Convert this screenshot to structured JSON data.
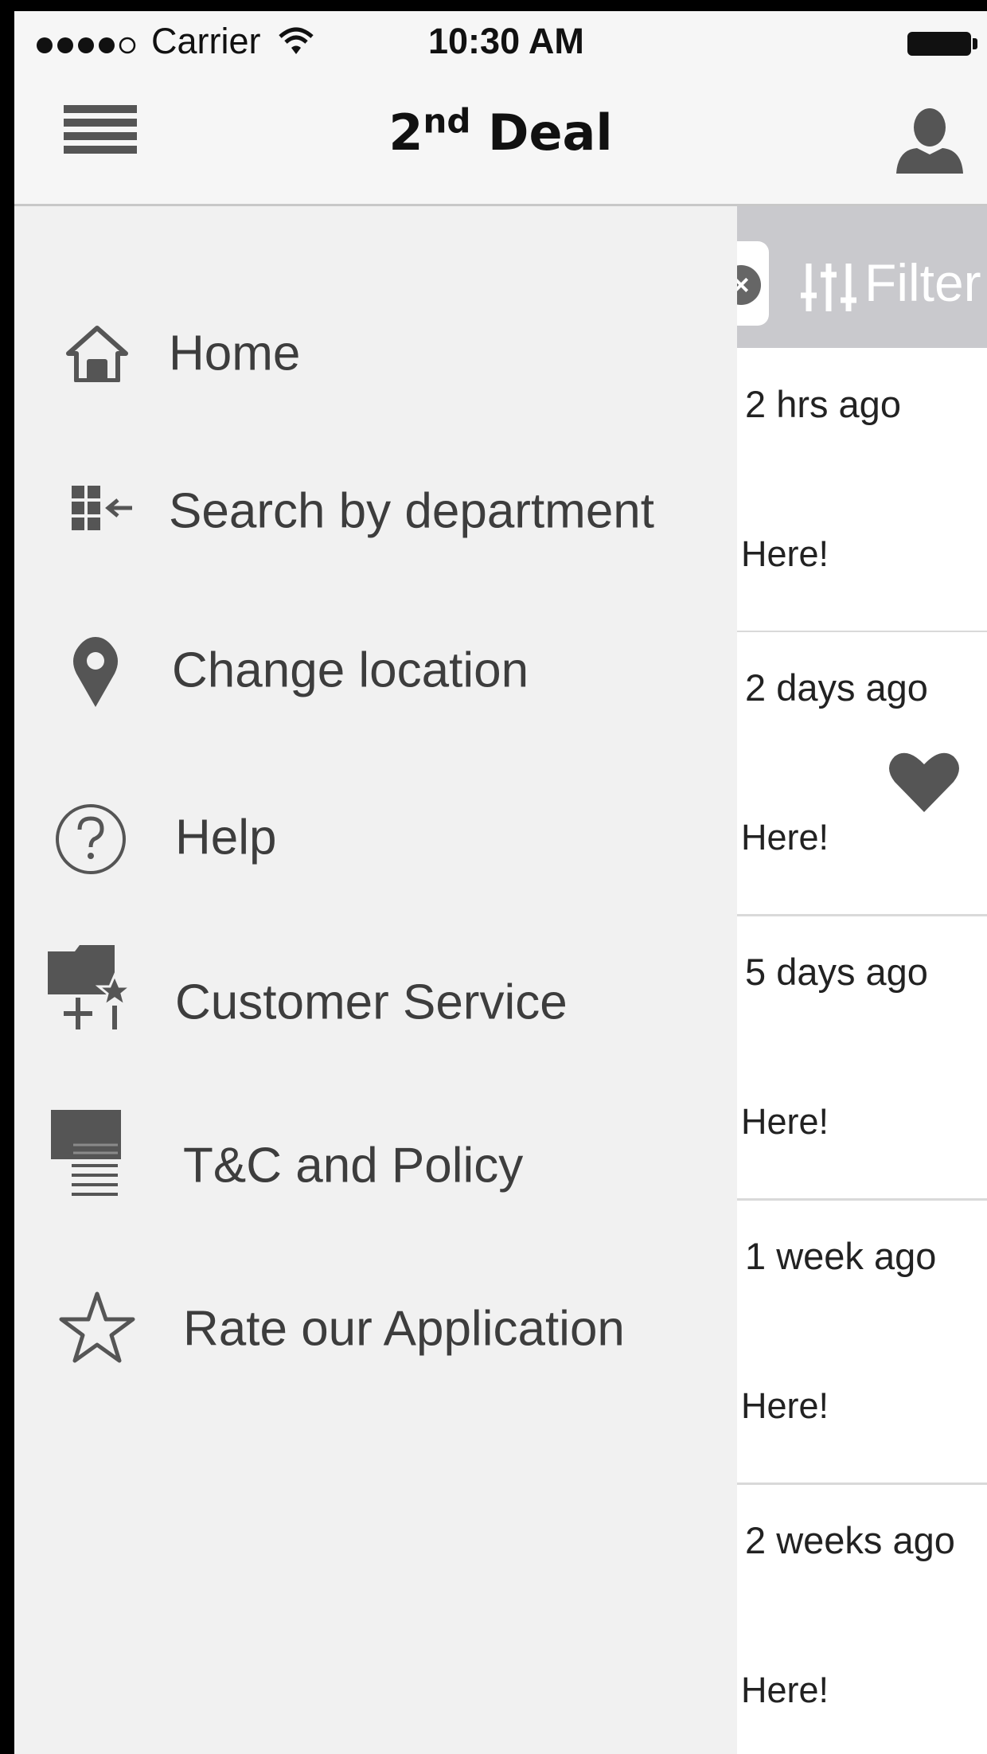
{
  "status_bar": {
    "carrier": "Carrier",
    "time": "10:30 AM"
  },
  "nav_bar": {
    "title_main": "2",
    "title_sup": "nd",
    "title_rest": " Deal"
  },
  "filter": {
    "clear_symbol": "×",
    "label": "Filter"
  },
  "list_rows": [
    {
      "time": "2 hrs ago",
      "text": "s Here!",
      "favorited": false
    },
    {
      "time": "2 days ago",
      "text": "s Here!",
      "favorited": true
    },
    {
      "time": "5 days ago",
      "text": "s Here!",
      "favorited": false
    },
    {
      "time": "1 week ago",
      "text": "s Here!",
      "favorited": false
    },
    {
      "time": "2 weeks ago",
      "text": "s Here!",
      "favorited": false
    }
  ],
  "drawer": {
    "items": [
      {
        "label": "Home",
        "icon": "home-icon"
      },
      {
        "label": "Search by department",
        "icon": "department-grid-icon"
      },
      {
        "label": "Change location",
        "icon": "location-pin-icon"
      },
      {
        "label": "Help",
        "icon": "help-icon"
      },
      {
        "label": "Customer Service",
        "icon": "customer-service-icon"
      },
      {
        "label": "T&C and Policy",
        "icon": "document-icon"
      },
      {
        "label": "Rate our Application",
        "icon": "star-icon"
      }
    ]
  },
  "colors": {
    "drawer_bg": "#f1f1f1",
    "filter_bar_bg": "#c9c9cd",
    "icon_gray": "#555555",
    "menu_text": "#3d3d3d"
  }
}
